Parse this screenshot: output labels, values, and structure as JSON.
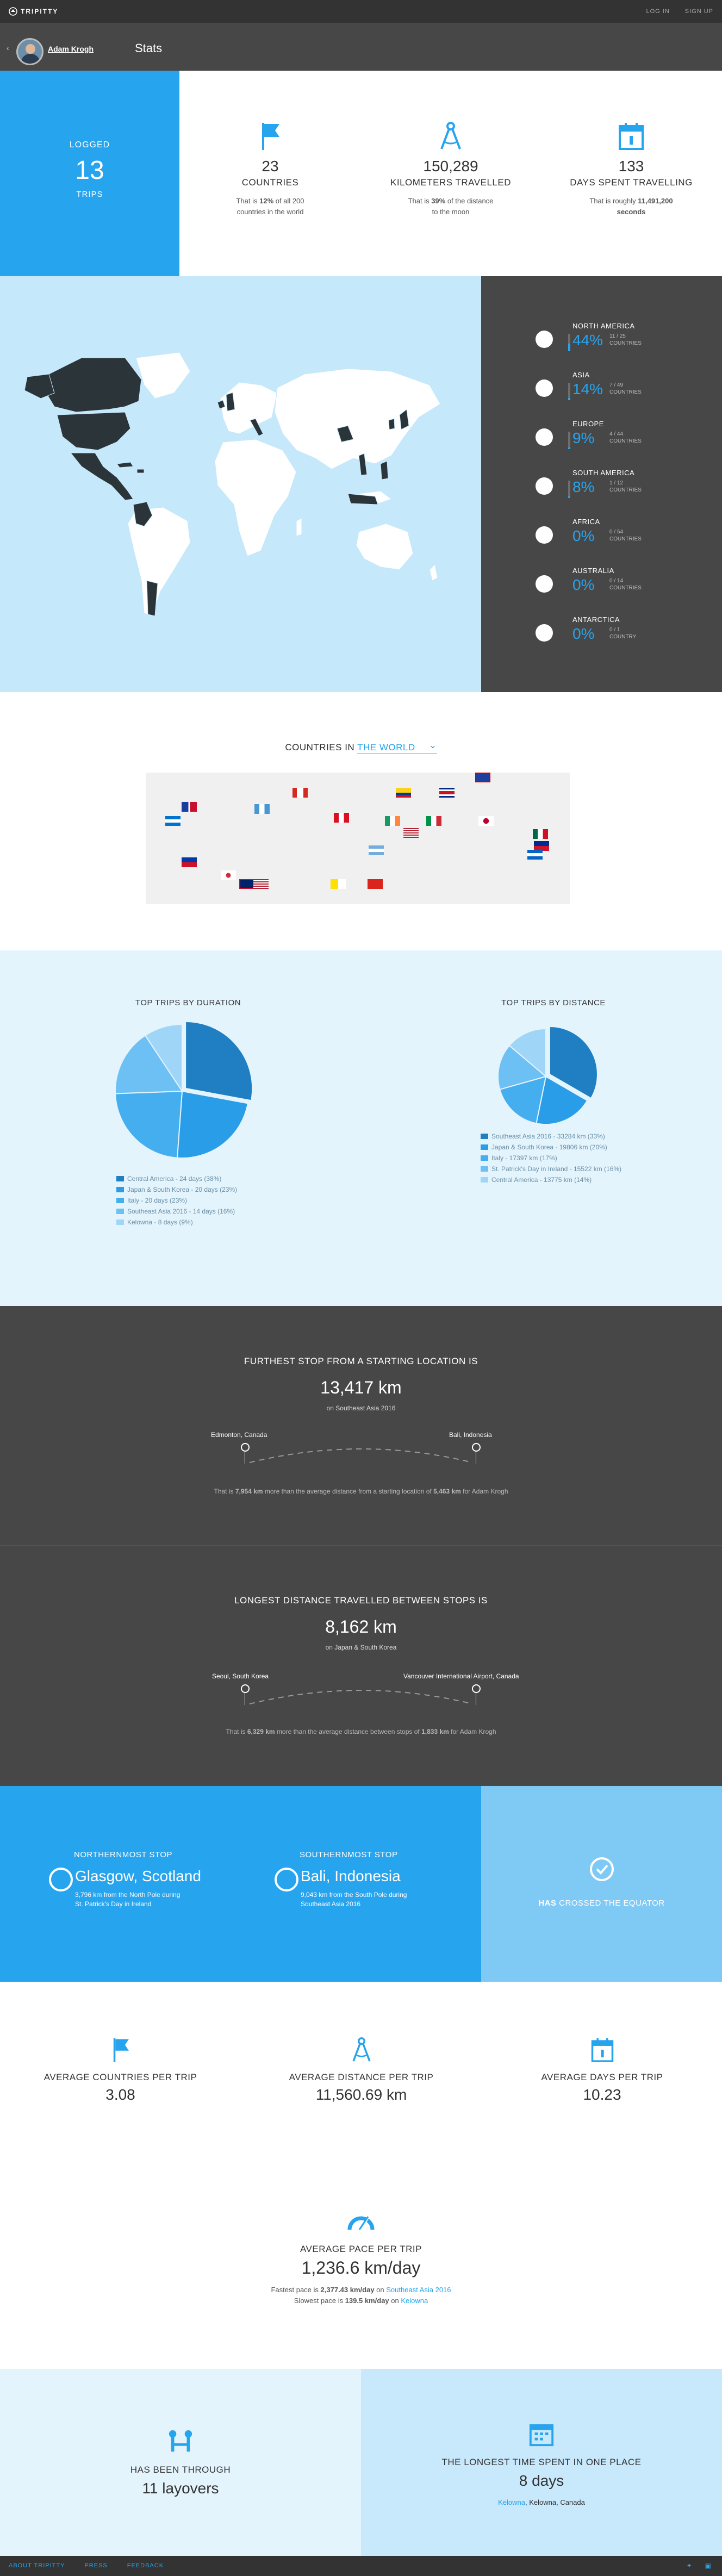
{
  "nav": {
    "logo": "TRIPITTY",
    "login": "LOG IN",
    "signup": "SIGN UP"
  },
  "profile": {
    "back": "‹",
    "name": "Adam Krogh",
    "title": "Stats"
  },
  "logged": {
    "line1": "LOGGED",
    "count": "13",
    "line3": "TRIPS"
  },
  "summary": [
    {
      "value": "23",
      "label": "COUNTRIES",
      "desc_pre": "That is ",
      "desc_bold": "12%",
      "desc_post": " of all 200 countries in the world"
    },
    {
      "value": "150,289",
      "label": "KILOMETERS TRAVELLED",
      "desc_pre": "That is ",
      "desc_bold": "39%",
      "desc_post": " of the distance to the moon"
    },
    {
      "value": "133",
      "label": "DAYS SPENT TRAVELLING",
      "desc_pre": "That is roughly ",
      "desc_bold": "11,491,200 seconds",
      "desc_post": ""
    }
  ],
  "continents": [
    {
      "name": "NORTH AMERICA",
      "percent": "44%",
      "count": "11 / 25",
      "unit": "COUNTRIES",
      "fill": 0.44,
      "icon": "north-america-icon"
    },
    {
      "name": "ASIA",
      "percent": "14%",
      "count": "7 / 49",
      "unit": "COUNTRIES",
      "fill": 0.14,
      "icon": "asia-icon"
    },
    {
      "name": "EUROPE",
      "percent": "9%",
      "count": "4 / 44",
      "unit": "COUNTRIES",
      "fill": 0.09,
      "icon": "europe-icon"
    },
    {
      "name": "SOUTH AMERICA",
      "percent": "8%",
      "count": "1 / 12",
      "unit": "COUNTRIES",
      "fill": 0.08,
      "icon": "south-america-icon"
    },
    {
      "name": "AFRICA",
      "percent": "0%",
      "count": "0 / 54",
      "unit": "COUNTRIES",
      "fill": 0,
      "icon": "africa-icon"
    },
    {
      "name": "AUSTRALIA",
      "percent": "0%",
      "count": "0 / 14",
      "unit": "COUNTRIES",
      "fill": 0,
      "icon": "australia-icon"
    },
    {
      "name": "ANTARCTICA",
      "percent": "0%",
      "count": "0 / 1",
      "unit": "COUNTRY",
      "fill": 0,
      "icon": "antarctica-icon"
    }
  ],
  "countries_in": {
    "prefix": "COUNTRIES IN ",
    "selected": "THE WORLD"
  },
  "flags": [
    "belize",
    "dominican-republic",
    "canada",
    "colombia",
    "costa-rica",
    "guatemala",
    "argentina",
    "peru",
    "japan",
    "ireland",
    "mexico",
    "italy",
    "usa",
    "mexico-2",
    "honduras",
    "philippines",
    "south-korea",
    "uk",
    "usa-2",
    "vatican",
    "vietnam",
    "cuba",
    "nicaragua"
  ],
  "top_trips_duration": {
    "title": "TOP TRIPS BY DURATION",
    "legend": [
      "Central America - 24 days (38%)",
      "Japan & South Korea - 20 days (23%)",
      "Italy - 20 days (23%)",
      "Southeast Asia 2016 - 14 days (16%)",
      "Kelowna - 8 days (9%)"
    ]
  },
  "top_trips_distance": {
    "title": "TOP TRIPS BY DISTANCE",
    "legend": [
      "Southeast Asia 2016 - 33284 km (33%)",
      "Japan & South Korea - 19806 km (20%)",
      "Italy - 17397 km (17%)",
      "St. Patrick's Day in Ireland - 15522 km (16%)",
      "Central America - 13775 km (14%)"
    ]
  },
  "chart_data": [
    {
      "type": "pie",
      "title": "TOP TRIPS BY DURATION",
      "categories": [
        "Central America",
        "Japan & South Korea",
        "Italy",
        "Southeast Asia 2016",
        "Kelowna"
      ],
      "values": [
        24,
        20,
        20,
        14,
        8
      ],
      "colors": [
        "#1f7fc2",
        "#2a9de8",
        "#45aeee",
        "#6dc0f3",
        "#9fd6f8"
      ]
    },
    {
      "type": "pie",
      "title": "TOP TRIPS BY DISTANCE",
      "categories": [
        "Southeast Asia 2016",
        "Japan & South Korea",
        "Italy",
        "St. Patrick's Day in Ireland",
        "Central America"
      ],
      "values": [
        33284,
        19806,
        17397,
        15522,
        13775
      ],
      "colors": [
        "#1f7fc2",
        "#2a9de8",
        "#45aeee",
        "#6dc0f3",
        "#9fd6f8"
      ]
    }
  ],
  "furthest": {
    "title": "FURTHEST STOP FROM A STARTING LOCATION IS",
    "value": "13,417 km",
    "on_pre": "on ",
    "on_link": "Southeast Asia 2016",
    "from": "Edmonton, Canada",
    "to": "Bali, Indonesia",
    "desc_pre": "That is ",
    "desc_b1": "7,954 km",
    "desc_mid": " more than the average distance from a starting location of ",
    "desc_b2": "5,463 km",
    "desc_post": " for Adam Krogh"
  },
  "longest": {
    "title": "LONGEST DISTANCE TRAVELLED BETWEEN STOPS IS",
    "value": "8,162 km",
    "on_pre": "on ",
    "on_link": "Japan & South Korea",
    "from": "Seoul, South Korea",
    "to": "Vancouver International Airport, Canada",
    "desc_pre": "That is ",
    "desc_b1": "6,329 km",
    "desc_mid": " more than the average distance between stops of ",
    "desc_b2": "1,833 km",
    "desc_post": " for Adam Krogh"
  },
  "north": {
    "head": "NORTHERNMOST STOP",
    "city": "Glasgow, Scotland",
    "desc": "3,796 km from the North Pole during",
    "link": "St. Patrick's Day in Ireland"
  },
  "south": {
    "head": "SOUTHERNMOST STOP",
    "city": "Bali, Indonesia",
    "desc": "9,043 km from the South Pole during",
    "link": "Southeast Asia 2016"
  },
  "equator": {
    "bold": "HAS",
    "rest": " CROSSED THE EQUATOR"
  },
  "averages": [
    {
      "label": "AVERAGE COUNTRIES PER TRIP",
      "value": "3.08"
    },
    {
      "label": "AVERAGE DISTANCE PER TRIP",
      "value": "11,560.69 km"
    },
    {
      "label": "AVERAGE DAYS PER TRIP",
      "value": "10.23"
    }
  ],
  "pace": {
    "label": "AVERAGE PACE PER TRIP",
    "value": "1,236.6 km/day",
    "fast_pre": "Fastest pace is ",
    "fast_val": "2,377.43 km/day",
    "fast_on": " on ",
    "fast_link": "Southeast Asia 2016",
    "slow_pre": "Slowest pace is ",
    "slow_val": "139.5 km/day",
    "slow_on": " on ",
    "slow_link": "Kelowna"
  },
  "layovers": {
    "label": "HAS BEEN THROUGH",
    "value": "11 layovers"
  },
  "longest_place": {
    "label": "THE LONGEST TIME SPENT IN ONE PLACE",
    "value": "8 days",
    "place_link": "Kelowna",
    "place_rest": ", Kelowna, Canada"
  },
  "footer": {
    "about": "ABOUT TRIPITTY",
    "press": "PRESS",
    "feedback": "FEEDBACK",
    "twitter": "twitter-icon",
    "facebook": "facebook-icon"
  },
  "colors": {
    "accent": "#27a4ee",
    "dark": "#474747",
    "light_blue": "#c5e8fb",
    "map_visited": "#2b3438"
  }
}
